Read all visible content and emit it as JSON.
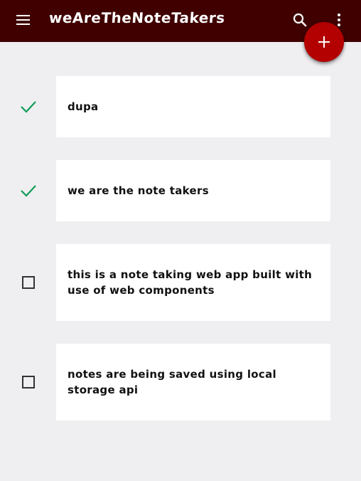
{
  "app": {
    "title": "weAreTheNoteTakers"
  },
  "toolbar": {
    "menu_icon": "menu-icon",
    "search_icon": "search-icon",
    "more_icon": "more-vert-icon",
    "add_icon": "plus-icon"
  },
  "colors": {
    "appbar": "#400000",
    "fab": "#b30000",
    "check_done": "#0f9d58",
    "background": "#efeff1"
  },
  "notes": [
    {
      "text": "dupa",
      "done": true
    },
    {
      "text": "we are the note takers",
      "done": true
    },
    {
      "text": "this is a note taking web app built with use of web components",
      "done": false
    },
    {
      "text": "notes are being saved using local storage api",
      "done": false
    }
  ]
}
